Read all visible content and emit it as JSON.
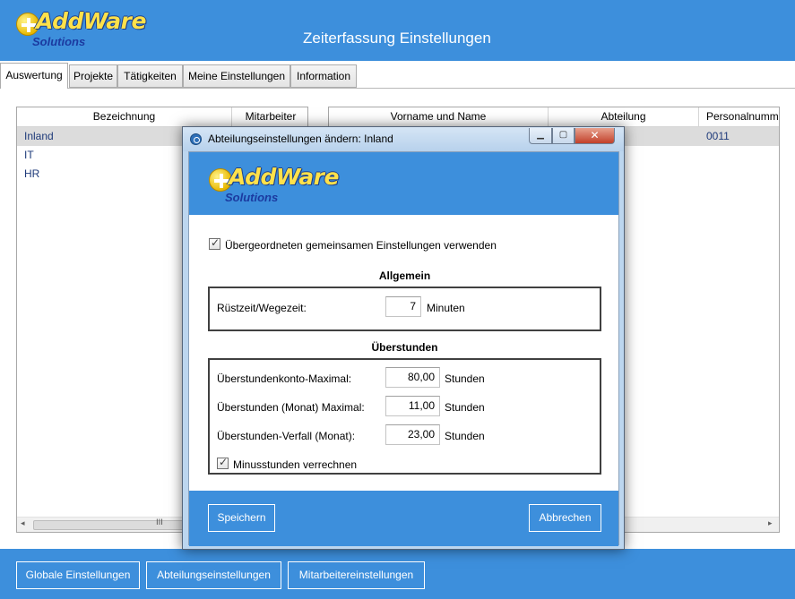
{
  "header": {
    "logo_text": "AddWare",
    "logo_sub": "Solutions",
    "title": "Zeiterfassung Einstellungen"
  },
  "tabs": [
    {
      "label": "Auswertung",
      "active": true
    },
    {
      "label": "Projekte"
    },
    {
      "label": "Tätigkeiten"
    },
    {
      "label": "Meine Einstellungen"
    },
    {
      "label": "Information"
    }
  ],
  "departments_table": {
    "columns": [
      "Bezeichnung",
      "Mitarbeiter"
    ],
    "rows": [
      "Inland",
      "IT",
      "HR"
    ],
    "scroll_grip": "III"
  },
  "employees_table": {
    "columns": [
      "Vorname und Name",
      "Abteilung",
      "Personalnumme"
    ],
    "rows": [
      {
        "personalnummer": "0011"
      }
    ]
  },
  "footer": {
    "global_settings": "Globale Einstellungen",
    "department_settings": "Abteilungseinstellungen",
    "employee_settings": "Mitarbeitereinstellungen"
  },
  "dialog": {
    "title": "Abteilungseinstellungen ändern: Inland",
    "logo_text": "AddWare",
    "logo_sub": "Solutions",
    "inherit_label": "Übergeordneten gemeinsamen Einstellungen verwenden",
    "inherit_checked": true,
    "general": {
      "title": "Allgemein",
      "setup_label": "Rüstzeit/Wegezeit:",
      "setup_value": "7",
      "setup_unit": "Minuten"
    },
    "overtime": {
      "title": "Überstunden",
      "max_account_label": "Überstundenkonto-Maximal:",
      "max_account_value": "80,00",
      "month_max_label": "Überstunden (Monat) Maximal:",
      "month_max_value": "11,00",
      "expiry_label": "Überstunden-Verfall (Monat):",
      "expiry_value": "23,00",
      "unit": "Stunden",
      "minus_label": "Minusstunden verrechnen",
      "minus_checked": true
    },
    "save_label": "Speichern",
    "cancel_label": "Abbrechen"
  }
}
